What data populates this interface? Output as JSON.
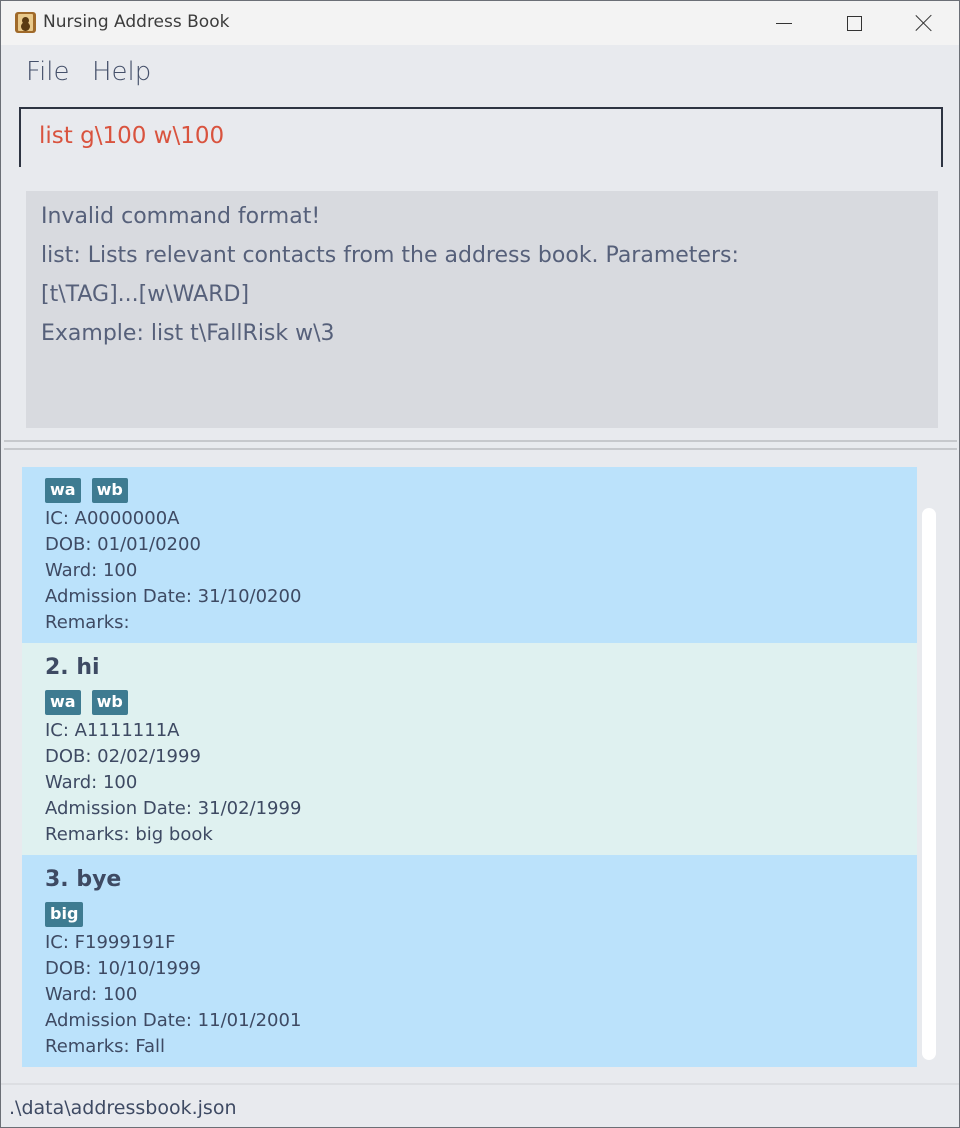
{
  "window": {
    "title": "Nursing Address Book",
    "icon": "address-book-icon"
  },
  "menu": {
    "file": "File",
    "help": "Help"
  },
  "command": {
    "value": "list g\\100 w\\100",
    "error_color": "#d9533e"
  },
  "result": {
    "lines": [
      "Invalid command format!",
      "list: Lists relevant contacts from the address book. Parameters:",
      "[t\\TAG]...[w\\WARD]",
      "Example: list t\\FallRisk w\\3"
    ]
  },
  "persons": [
    {
      "name": "",
      "tags": [
        "wa",
        "wb"
      ],
      "ic": "IC: A0000000A",
      "dob": "DOB: 01/01/0200",
      "ward": "Ward: 100",
      "admission": "Admission Date: 31/10/0200",
      "remarks": "Remarks:"
    },
    {
      "name": "2.  hi",
      "tags": [
        "wa",
        "wb"
      ],
      "ic": "IC: A1111111A",
      "dob": "DOB: 02/02/1999",
      "ward": "Ward: 100",
      "admission": "Admission Date: 31/02/1999",
      "remarks": "Remarks: big book"
    },
    {
      "name": "3.  bye",
      "tags": [
        "big"
      ],
      "ic": "IC: F1999191F",
      "dob": "DOB: 10/10/1999",
      "ward": "Ward: 100",
      "admission": "Admission Date: 11/01/2001",
      "remarks": "Remarks: Fall"
    }
  ],
  "colors": {
    "card_blue": "#bbe2fb",
    "card_mint": "#dff1f0",
    "tag": "#3e7b91"
  },
  "status": {
    "path": ".\\data\\addressbook.json"
  }
}
